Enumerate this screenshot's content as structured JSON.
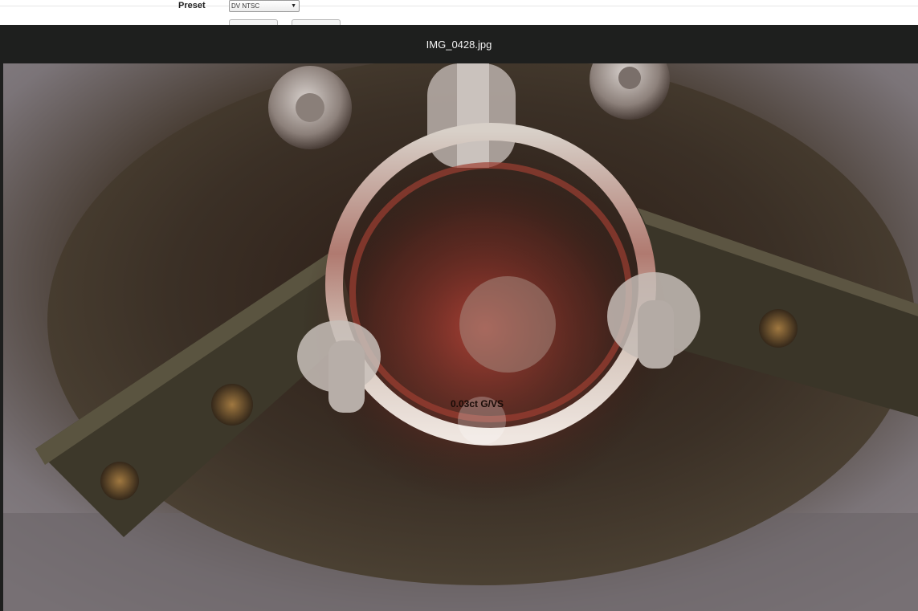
{
  "background_page": {
    "preset_label": "Preset",
    "preset_value": "DV NTSC"
  },
  "lightbox": {
    "title": "IMG_0428.jpg",
    "photo": {
      "engraving": "0.03ct G/VS"
    }
  }
}
